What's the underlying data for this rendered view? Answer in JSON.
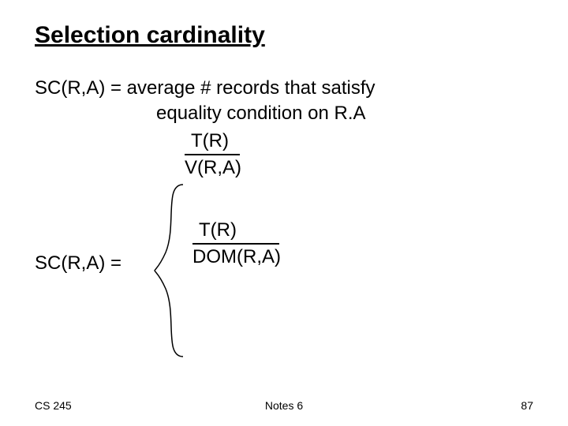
{
  "title": "Selection cardinality",
  "definition": {
    "line1": "SC(R,A) = average # records that satisfy",
    "line2": "equality condition on R.A"
  },
  "left_label": "SC(R,A) =",
  "fraction1": {
    "numerator": "T(R)",
    "denominator": "V(R,A)"
  },
  "fraction2": {
    "numerator": "T(R)",
    "denominator": "DOM(R,A)"
  },
  "footer": {
    "left": "CS 245",
    "center": "Notes 6",
    "right": "87"
  }
}
